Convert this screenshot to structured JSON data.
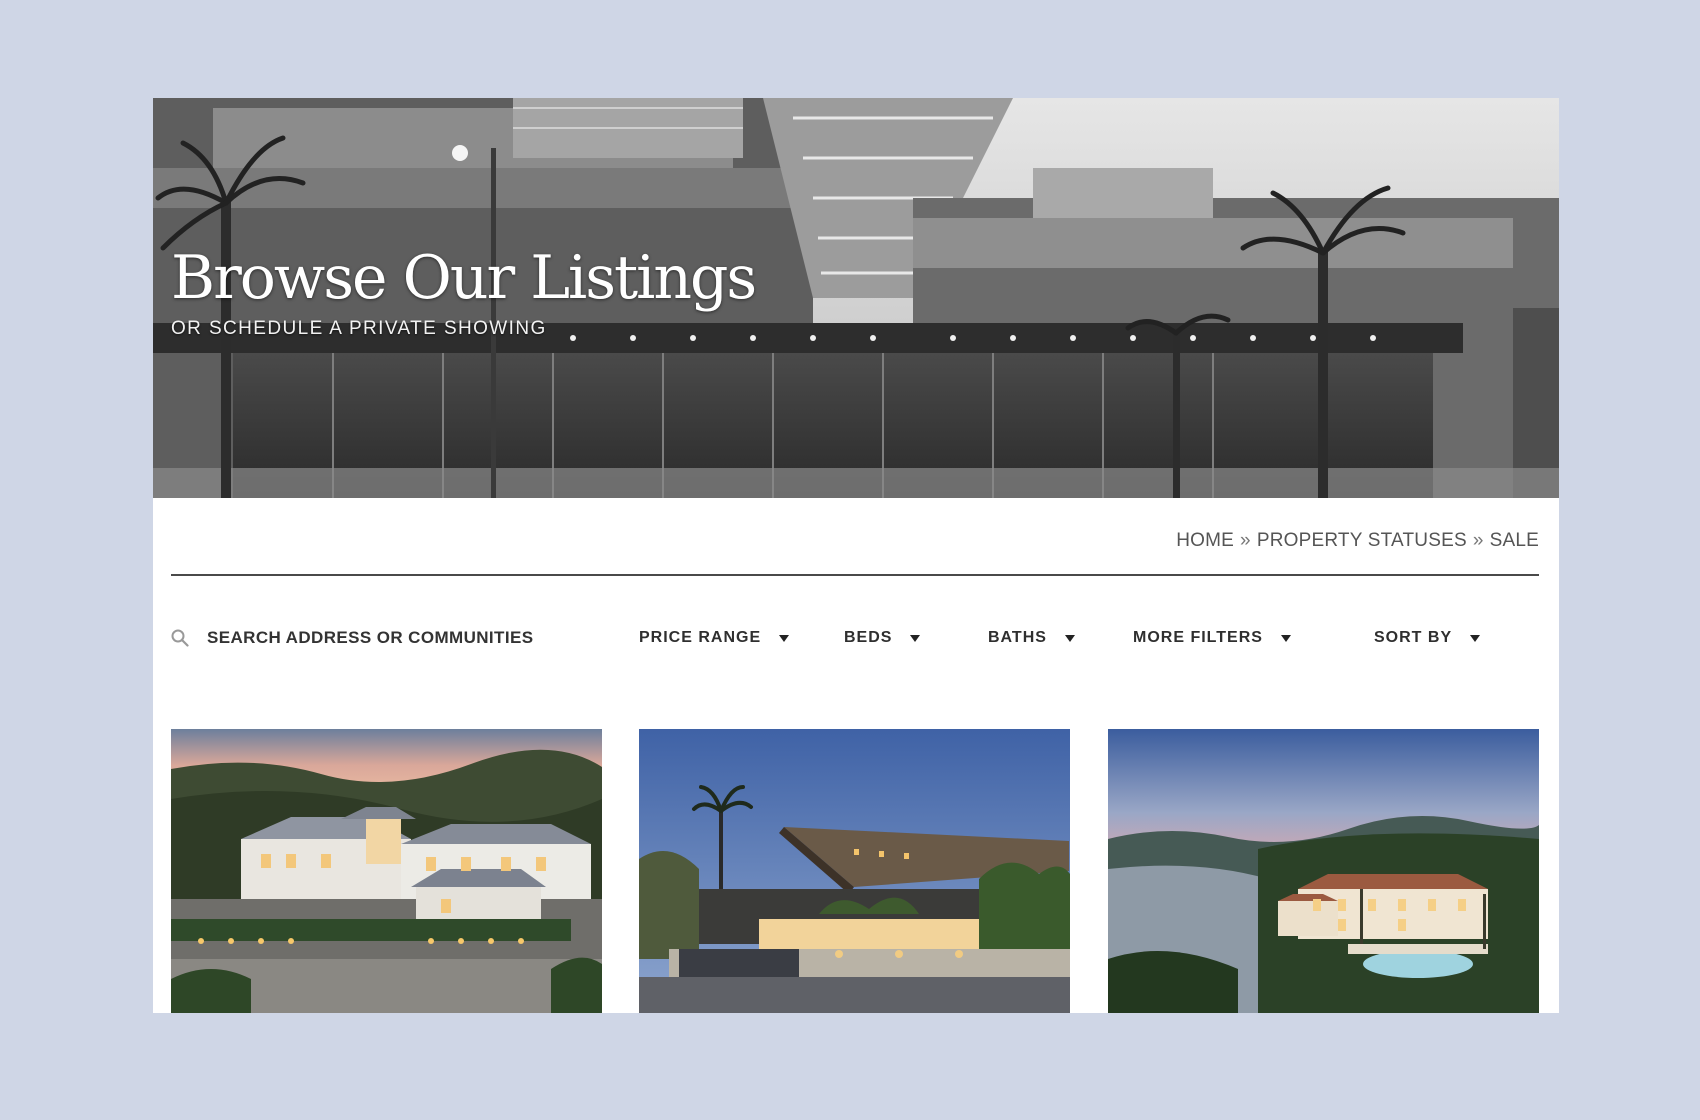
{
  "hero": {
    "title": "Browse Our Listings",
    "subtitle": "OR SCHEDULE A PRIVATE SHOWING"
  },
  "breadcrumb": {
    "items": [
      "HOME",
      "PROPERTY STATUSES",
      "SALE"
    ],
    "separator": "»"
  },
  "search": {
    "placeholder": "SEARCH ADDRESS OR COMMUNITIES",
    "value": ""
  },
  "filters": {
    "price": "PRICE RANGE",
    "beds": "BEDS",
    "baths": "BATHS",
    "more": "MORE FILTERS",
    "sort": "SORT BY"
  },
  "colors": {
    "page_background": "#cfd6e6",
    "panel": "#ffffff",
    "text": "#2f2f2f",
    "rule": "#4a4a4a"
  },
  "icons": {
    "search": "search-icon",
    "dropdown": "caret-down-icon"
  }
}
